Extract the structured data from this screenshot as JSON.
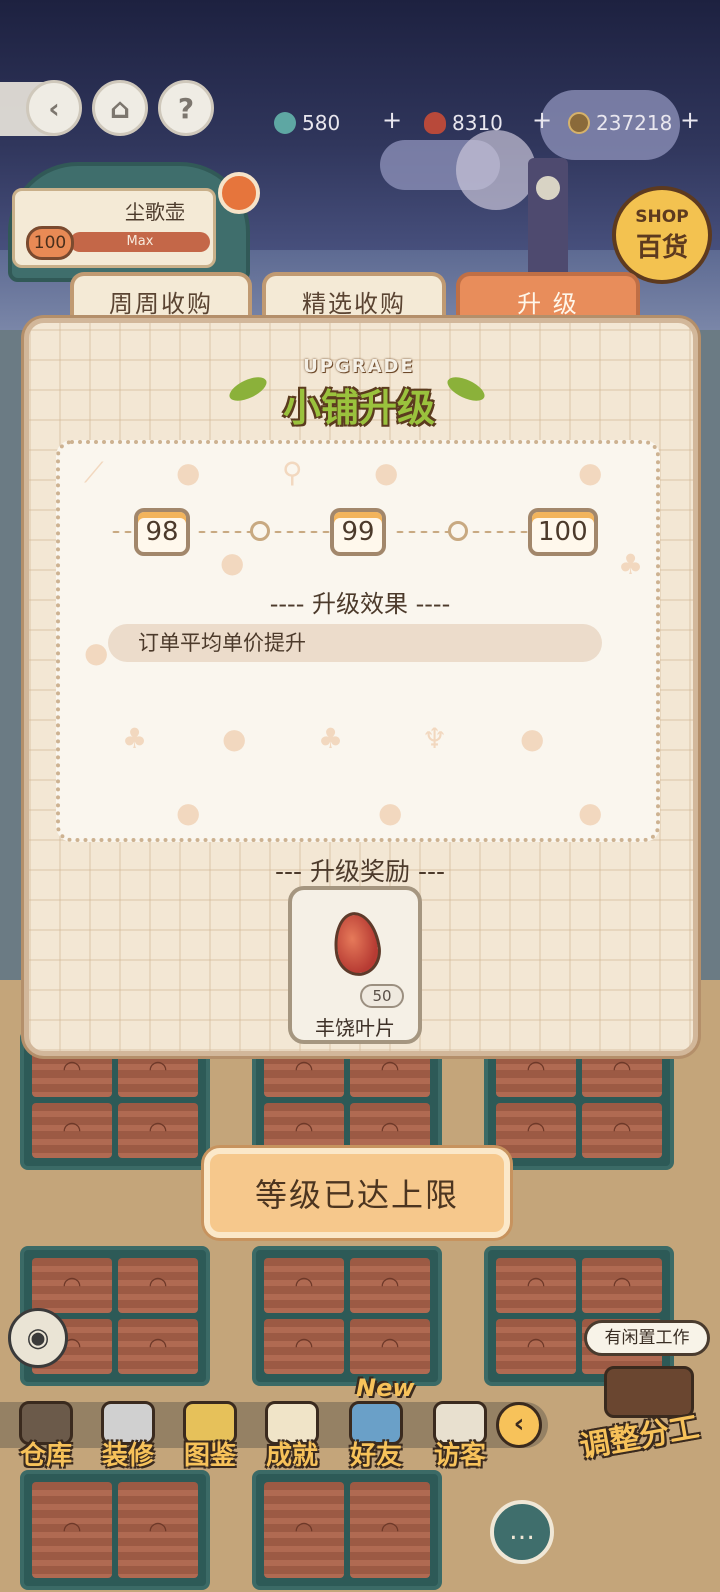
{
  "top_bar": {
    "back_icon": "back-arrow-icon",
    "home_icon": "home-icon",
    "help_label": "?",
    "currencies": [
      {
        "icon": "gem-icon",
        "value": "580",
        "plus": "+"
      },
      {
        "icon": "leaf-icon",
        "value": "8310",
        "plus": "+"
      },
      {
        "icon": "coin-icon",
        "value": "237218",
        "plus": "+"
      }
    ]
  },
  "shop": {
    "name": "尘歌壶",
    "level": "100",
    "progress_label": "Max",
    "progress_fraction": 1.0,
    "shop_badge_en": "SHOP",
    "shop_badge_zh": "百货"
  },
  "tabs": [
    {
      "label": "周周收购",
      "active": false
    },
    {
      "label": "精选收购",
      "active": false
    },
    {
      "label": "升 级",
      "active": true
    }
  ],
  "panel": {
    "title_en": "UPGRADE",
    "title_zh": "小铺升级",
    "levels": [
      "98",
      "99",
      "100"
    ],
    "effect_heading": "----  升级效果  ----",
    "effect_text": "订单平均单价提升",
    "reward_heading": "--- 升级奖励 ---",
    "reward": {
      "icon": "leaf-item-icon",
      "quantity": "50",
      "name": "丰饶叶片"
    },
    "max_button": "等级已达上限"
  },
  "bottom_nav": {
    "items": [
      {
        "label": "仓库",
        "color": "#6b5a4a"
      },
      {
        "label": "装修",
        "color": "#d0d0d0"
      },
      {
        "label": "图鉴",
        "color": "#e6c15a"
      },
      {
        "label": "成就",
        "color": "#f0e4c8"
      },
      {
        "label": "好友",
        "color": "#6aa0c8"
      },
      {
        "label": "访客",
        "color": "#e8e0cf"
      }
    ],
    "new_tag": "New",
    "idle_bubble": "有闲置工作",
    "assign_label": "调整分工"
  },
  "colors": {
    "tab_active": "#e88d5b",
    "panel_bg": "#f3e7d4",
    "button_bg": "#f6c88c"
  }
}
